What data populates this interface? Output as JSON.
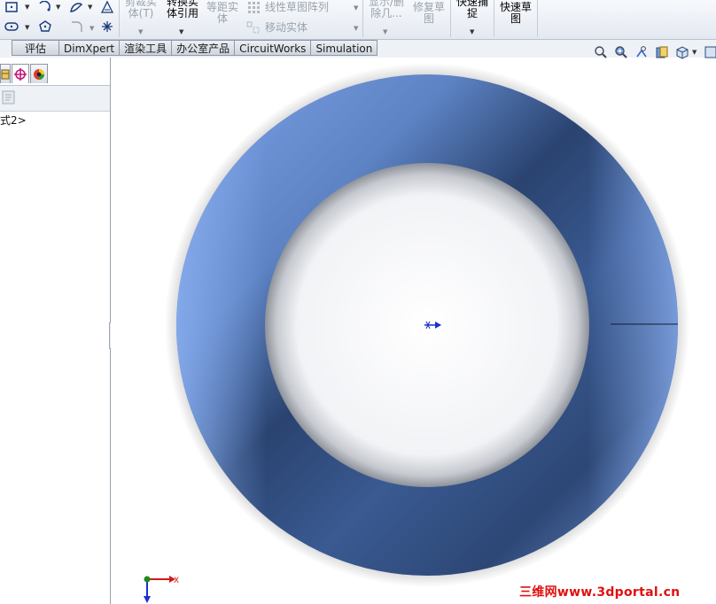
{
  "ribbon": {
    "trim_entities": "剪裁实\n体(T)",
    "convert_entities": "转换实\n体引用",
    "offset_entities": "等距实\n体",
    "linear_pattern": "线性草图阵列",
    "move_entities": "移动实体",
    "show_delete_relations": "显示/删\n除几...",
    "repair_sketch": "修复草\n图",
    "quick_snaps": "快速捕\n捉",
    "rapid_sketch": "快速草\n图"
  },
  "tabs": [
    "评估",
    "DimXpert",
    "渲染工具",
    "办公室产品",
    "CircuitWorks",
    "Simulation"
  ],
  "tree": {
    "item": "式2>"
  },
  "axes": {
    "x_label": "X"
  },
  "watermark": "三维网www.3dportal.cn",
  "colors": {
    "ring_light": "#7ea3e8",
    "ring_dark": "#2a4370",
    "watermark": "#e01010",
    "axis_x": "#d21a1a",
    "axis_y": "#1a2fd2",
    "origin": "#1c8a1c"
  }
}
